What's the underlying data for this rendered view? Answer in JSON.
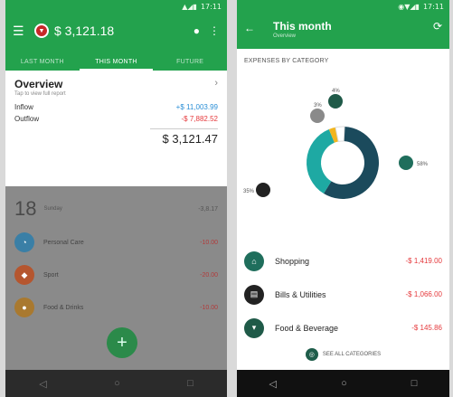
{
  "left": {
    "status": {
      "time": "17:11"
    },
    "appbar": {
      "balance": "$ 3,121.18"
    },
    "tabs": [
      "LAST MONTH",
      "THIS MONTH",
      "FUTURE"
    ],
    "overview": {
      "title": "Overview",
      "subtitle": "Tap to view full report",
      "inflow_label": "Inflow",
      "inflow_value": "+$ 11,003.99",
      "outflow_label": "Outflow",
      "outflow_value": "-$ 7,882.52",
      "total": "$ 3,121.47"
    },
    "day": {
      "number": "18",
      "info": "Sunday",
      "total": "-3,8.17"
    },
    "transactions": [
      {
        "name": "Personal Care",
        "amount": "-10.00",
        "color": "#3a9fd6",
        "icon": "personal-care-icon"
      },
      {
        "name": "Sport",
        "amount": "-20.00",
        "color": "#e06a3a",
        "icon": "sport-icon"
      },
      {
        "name": "Food & Drinks",
        "amount": "-10.00",
        "color": "#d69a3a",
        "icon": "food-icon"
      }
    ]
  },
  "right": {
    "status": {
      "time": "17:11"
    },
    "appbar": {
      "title": "This month",
      "subtitle": "Overview"
    },
    "section_title": "EXPENSES BY CATEGORY",
    "chart_data": {
      "type": "pie",
      "categories": [
        "Shopping",
        "Bills & Utilities",
        "Food & Beverage",
        "Other"
      ],
      "values": [
        58,
        35,
        3,
        4
      ],
      "labels": [
        "58%",
        "35%",
        "3%",
        "4%"
      ],
      "colors": [
        "#1b4a5c",
        "#1ea9a3",
        "#f2b51d",
        "#ffffff"
      ]
    },
    "legend": [
      {
        "name": "Shopping",
        "amount": "-$ 1,419.00",
        "color": "#1f6e5c",
        "icon": "basket-icon"
      },
      {
        "name": "Bills & Utilities",
        "amount": "-$ 1,066.00",
        "color": "#222222",
        "icon": "bill-icon"
      },
      {
        "name": "Food & Beverage",
        "amount": "-$ 145.86",
        "color": "#1f5a48",
        "icon": "food-beverage-icon"
      }
    ],
    "see_all": "SEE ALL CATEGORIES"
  }
}
